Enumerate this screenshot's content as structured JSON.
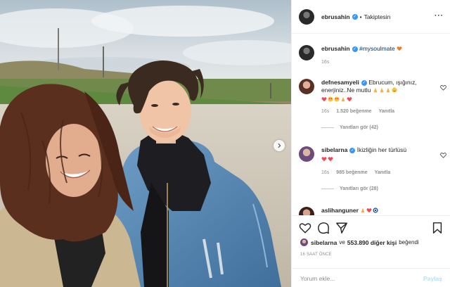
{
  "post": {
    "author": "ebrusahin",
    "follow_state": "Takiptesin",
    "dot": "•"
  },
  "caption": {
    "author": "ebrusahin",
    "hashtag": "#mysoulmate",
    "time": "16s"
  },
  "comments": [
    {
      "author": "defnesamyeli",
      "text": "Ebrucum, ışığınız, enerjiniz..Ne mutlu",
      "time": "16s",
      "likes": "1.520 beğenme",
      "reply_label": "Yanıtla",
      "view_replies": "Yanıtları gör (42)"
    },
    {
      "author": "sibelarna",
      "text": "İkizliğin her türlüsü",
      "time": "16s",
      "likes": "985 beğenme",
      "reply_label": "Yanıtla",
      "view_replies": "Yanıtları gör (28)"
    },
    {
      "author": "aslihanguner"
    }
  ],
  "likes_summary": {
    "user": "sibelarna",
    "joiner": "ve",
    "others": "553.890 diğer kişi",
    "verb": "beğendi"
  },
  "timestamp": "16 SAAT ÖNCE",
  "comment_input": {
    "placeholder": "Yorum ekle...",
    "post_label": "Paylaş"
  },
  "colors": {
    "verified": "#3897f0",
    "link": "#00376b",
    "heart": "#ed4956",
    "muted": "#8e8e8e"
  },
  "icons": [
    "verified-badge-icon",
    "more-options-icon",
    "heart-icon",
    "comment-icon",
    "share-icon",
    "bookmark-icon",
    "chevron-right-icon"
  ]
}
